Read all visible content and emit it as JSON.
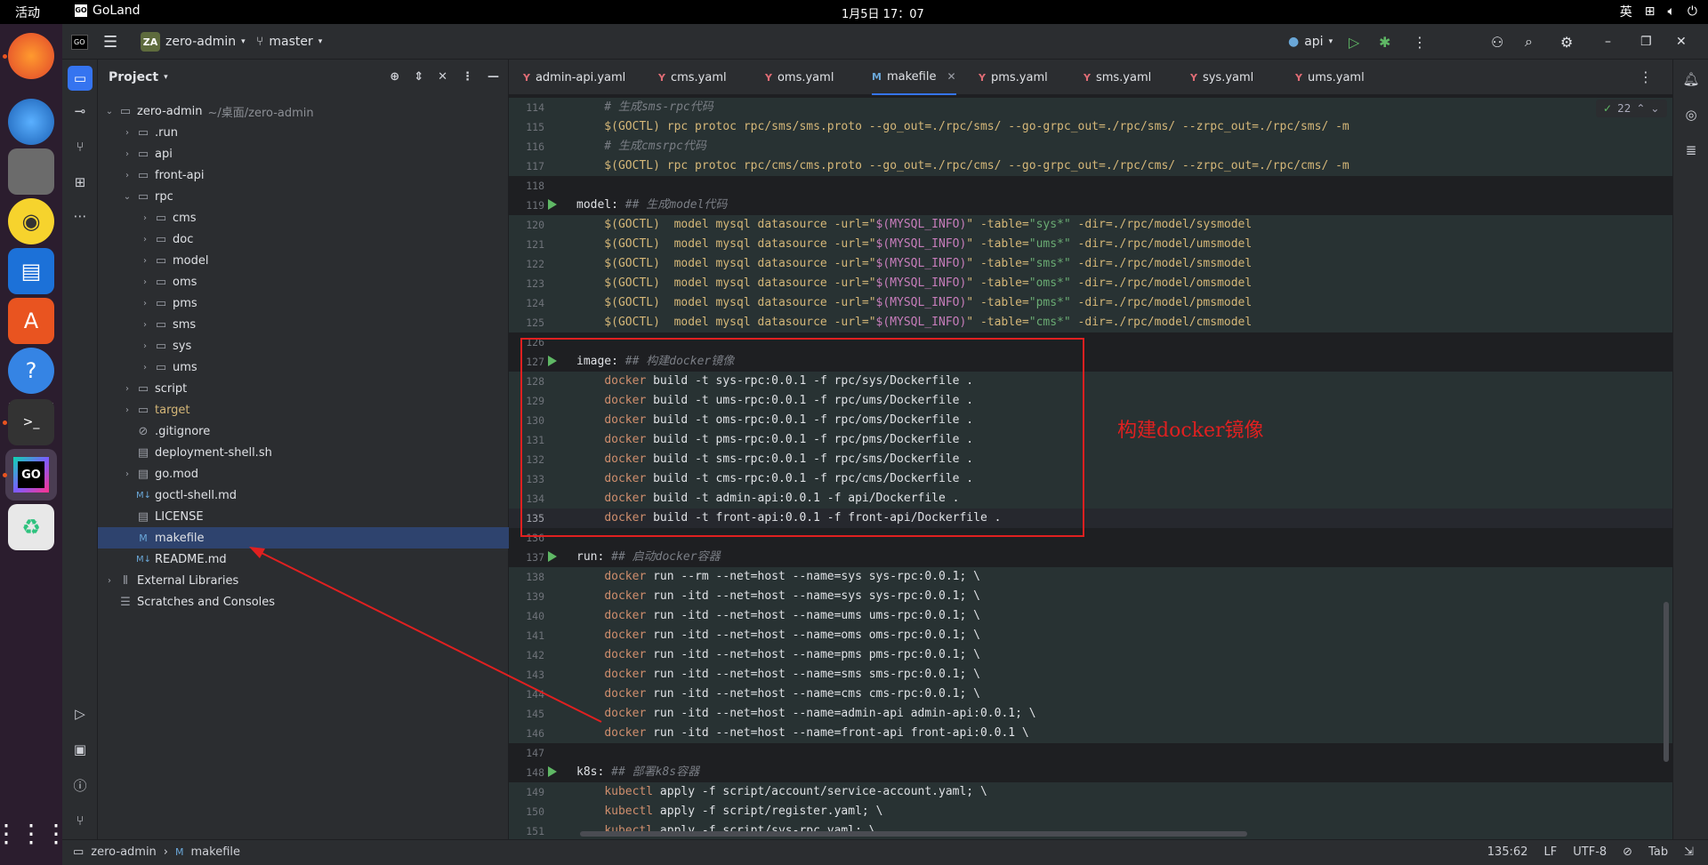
{
  "system": {
    "activities": "活动",
    "app_name": "GoLand",
    "clock": "1月5日 17：07",
    "ime": "英"
  },
  "ide": {
    "project_badge": "ZA",
    "project_name": "zero-admin",
    "branch": "master",
    "run_config": "api"
  },
  "project_panel": {
    "title": "Project",
    "tree": [
      {
        "label": "zero-admin",
        "path": "~/桌面/zero-admin",
        "depth": 0,
        "type": "folder",
        "open": true
      },
      {
        "label": ".run",
        "depth": 1,
        "type": "folder"
      },
      {
        "label": "api",
        "depth": 1,
        "type": "folder"
      },
      {
        "label": "front-api",
        "depth": 1,
        "type": "folder"
      },
      {
        "label": "rpc",
        "depth": 1,
        "type": "folder",
        "open": true
      },
      {
        "label": "cms",
        "depth": 2,
        "type": "folder"
      },
      {
        "label": "doc",
        "depth": 2,
        "type": "folder"
      },
      {
        "label": "model",
        "depth": 2,
        "type": "folder"
      },
      {
        "label": "oms",
        "depth": 2,
        "type": "folder"
      },
      {
        "label": "pms",
        "depth": 2,
        "type": "folder"
      },
      {
        "label": "sms",
        "depth": 2,
        "type": "folder"
      },
      {
        "label": "sys",
        "depth": 2,
        "type": "folder"
      },
      {
        "label": "ums",
        "depth": 2,
        "type": "folder"
      },
      {
        "label": "script",
        "depth": 1,
        "type": "folder"
      },
      {
        "label": "target",
        "depth": 1,
        "type": "folder",
        "excluded": true
      },
      {
        "label": ".gitignore",
        "depth": 1,
        "type": "file"
      },
      {
        "label": "deployment-shell.sh",
        "depth": 1,
        "type": "file"
      },
      {
        "label": "go.mod",
        "depth": 1,
        "type": "file"
      },
      {
        "label": "goctl-shell.md",
        "depth": 1,
        "type": "md"
      },
      {
        "label": "LICENSE",
        "depth": 1,
        "type": "file"
      },
      {
        "label": "makefile",
        "depth": 1,
        "type": "make",
        "selected": true
      },
      {
        "label": "README.md",
        "depth": 1,
        "type": "md"
      },
      {
        "label": "External Libraries",
        "depth": 0,
        "type": "lib"
      },
      {
        "label": "Scratches and Consoles",
        "depth": 0,
        "type": "scratch"
      }
    ]
  },
  "tabs": [
    {
      "label": "admin-api.yaml"
    },
    {
      "label": "cms.yaml"
    },
    {
      "label": "oms.yaml"
    },
    {
      "label": "makefile",
      "active": true
    },
    {
      "label": "pms.yaml"
    },
    {
      "label": "sms.yaml"
    },
    {
      "label": "sys.yaml"
    },
    {
      "label": "ums.yaml"
    }
  ],
  "editor": {
    "problems_count": "22",
    "lines": [
      {
        "n": "114",
        "block": true,
        "code": "    # 生成sms-rpc代码",
        "kind": "cmt"
      },
      {
        "n": "115",
        "block": true,
        "code": "    $(GOCTL) rpc protoc rpc/sms/sms.proto --go_out=./rpc/sms/ --go-grpc_out=./rpc/sms/ --zrpc_out=./rpc/sms/ -m",
        "kind": "var"
      },
      {
        "n": "116",
        "block": true,
        "code": "    # 生成cmsrpc代码",
        "kind": "cmt"
      },
      {
        "n": "117",
        "block": true,
        "code": "    $(GOCTL) rpc protoc rpc/cms/cms.proto --go_out=./rpc/cms/ --go-grpc_out=./rpc/cms/ --zrpc_out=./rpc/cms/ -m",
        "kind": "var"
      },
      {
        "n": "118",
        "block": false,
        "code": "",
        "kind": "plain"
      },
      {
        "n": "119",
        "block": false,
        "code": "model: ## 生成model代码",
        "kind": "target",
        "run": true
      },
      {
        "n": "120",
        "block": true,
        "code": "    $(GOCTL)  model mysql datasource -url=\"$(MYSQL_INFO)\" -table=\"sys*\" -dir=./rpc/model/sysmodel",
        "kind": "var"
      },
      {
        "n": "121",
        "block": true,
        "code": "    $(GOCTL)  model mysql datasource -url=\"$(MYSQL_INFO)\" -table=\"ums*\" -dir=./rpc/model/umsmodel",
        "kind": "var"
      },
      {
        "n": "122",
        "block": true,
        "code": "    $(GOCTL)  model mysql datasource -url=\"$(MYSQL_INFO)\" -table=\"sms*\" -dir=./rpc/model/smsmodel",
        "kind": "var"
      },
      {
        "n": "123",
        "block": true,
        "code": "    $(GOCTL)  model mysql datasource -url=\"$(MYSQL_INFO)\" -table=\"oms*\" -dir=./rpc/model/omsmodel",
        "kind": "var"
      },
      {
        "n": "124",
        "block": true,
        "code": "    $(GOCTL)  model mysql datasource -url=\"$(MYSQL_INFO)\" -table=\"pms*\" -dir=./rpc/model/pmsmodel",
        "kind": "var"
      },
      {
        "n": "125",
        "block": true,
        "code": "    $(GOCTL)  model mysql datasource -url=\"$(MYSQL_INFO)\" -table=\"cms*\" -dir=./rpc/model/cmsmodel",
        "kind": "var"
      },
      {
        "n": "126",
        "block": false,
        "code": "",
        "kind": "plain"
      },
      {
        "n": "127",
        "block": false,
        "code": "image: ## 构建docker镜像",
        "kind": "target",
        "run": true
      },
      {
        "n": "128",
        "block": true,
        "code": "    docker build -t sys-rpc:0.0.1 -f rpc/sys/Dockerfile .",
        "kind": "cmd"
      },
      {
        "n": "129",
        "block": true,
        "code": "    docker build -t ums-rpc:0.0.1 -f rpc/ums/Dockerfile .",
        "kind": "cmd"
      },
      {
        "n": "130",
        "block": true,
        "code": "    docker build -t oms-rpc:0.0.1 -f rpc/oms/Dockerfile .",
        "kind": "cmd"
      },
      {
        "n": "131",
        "block": true,
        "code": "    docker build -t pms-rpc:0.0.1 -f rpc/pms/Dockerfile .",
        "kind": "cmd"
      },
      {
        "n": "132",
        "block": true,
        "code": "    docker build -t sms-rpc:0.0.1 -f rpc/sms/Dockerfile .",
        "kind": "cmd"
      },
      {
        "n": "133",
        "block": true,
        "code": "    docker build -t cms-rpc:0.0.1 -f rpc/cms/Dockerfile .",
        "kind": "cmd"
      },
      {
        "n": "134",
        "block": true,
        "code": "    docker build -t admin-api:0.0.1 -f api/Dockerfile .",
        "kind": "cmd"
      },
      {
        "n": "135",
        "block": true,
        "cur": true,
        "code": "    docker build -t front-api:0.0.1 -f front-api/Dockerfile .",
        "kind": "cmd"
      },
      {
        "n": "136",
        "block": false,
        "code": "",
        "kind": "plain"
      },
      {
        "n": "137",
        "block": false,
        "code": "run: ## 启动docker容器",
        "kind": "target",
        "run": true
      },
      {
        "n": "138",
        "block": true,
        "code": "    docker run --rm --net=host --name=sys sys-rpc:0.0.1; \\",
        "kind": "cmd"
      },
      {
        "n": "139",
        "block": true,
        "code": "    docker run -itd --net=host --name=sys sys-rpc:0.0.1; \\",
        "kind": "cmd"
      },
      {
        "n": "140",
        "block": true,
        "code": "    docker run -itd --net=host --name=ums ums-rpc:0.0.1; \\",
        "kind": "cmd"
      },
      {
        "n": "141",
        "block": true,
        "code": "    docker run -itd --net=host --name=oms oms-rpc:0.0.1; \\",
        "kind": "cmd"
      },
      {
        "n": "142",
        "block": true,
        "code": "    docker run -itd --net=host --name=pms pms-rpc:0.0.1; \\",
        "kind": "cmd"
      },
      {
        "n": "143",
        "block": true,
        "code": "    docker run -itd --net=host --name=sms sms-rpc:0.0.1; \\",
        "kind": "cmd"
      },
      {
        "n": "144",
        "block": true,
        "code": "    docker run -itd --net=host --name=cms cms-rpc:0.0.1; \\",
        "kind": "cmd"
      },
      {
        "n": "145",
        "block": true,
        "code": "    docker run -itd --net=host --name=admin-api admin-api:0.0.1; \\",
        "kind": "cmd"
      },
      {
        "n": "146",
        "block": true,
        "code": "    docker run -itd --net=host --name=front-api front-api:0.0.1 \\",
        "kind": "cmd"
      },
      {
        "n": "147",
        "block": false,
        "code": "",
        "kind": "plain"
      },
      {
        "n": "148",
        "block": false,
        "code": "k8s: ## 部署k8s容器",
        "kind": "target",
        "run": true
      },
      {
        "n": "149",
        "block": true,
        "code": "    kubectl apply -f script/account/service-account.yaml; \\",
        "kind": "cmd"
      },
      {
        "n": "150",
        "block": true,
        "code": "    kubectl apply -f script/register.yaml; \\",
        "kind": "cmd"
      },
      {
        "n": "151",
        "block": true,
        "code": "    kubectl apply -f script/sys-rpc.yaml; \\",
        "kind": "cmd"
      }
    ]
  },
  "annotation": {
    "text": "构建docker镜像",
    "color": "#e02020"
  },
  "statusbar": {
    "crumb_project": "zero-admin",
    "crumb_file": "makefile",
    "position": "135:62",
    "line_sep": "LF",
    "encoding": "UTF-8",
    "indent": "Tab"
  }
}
